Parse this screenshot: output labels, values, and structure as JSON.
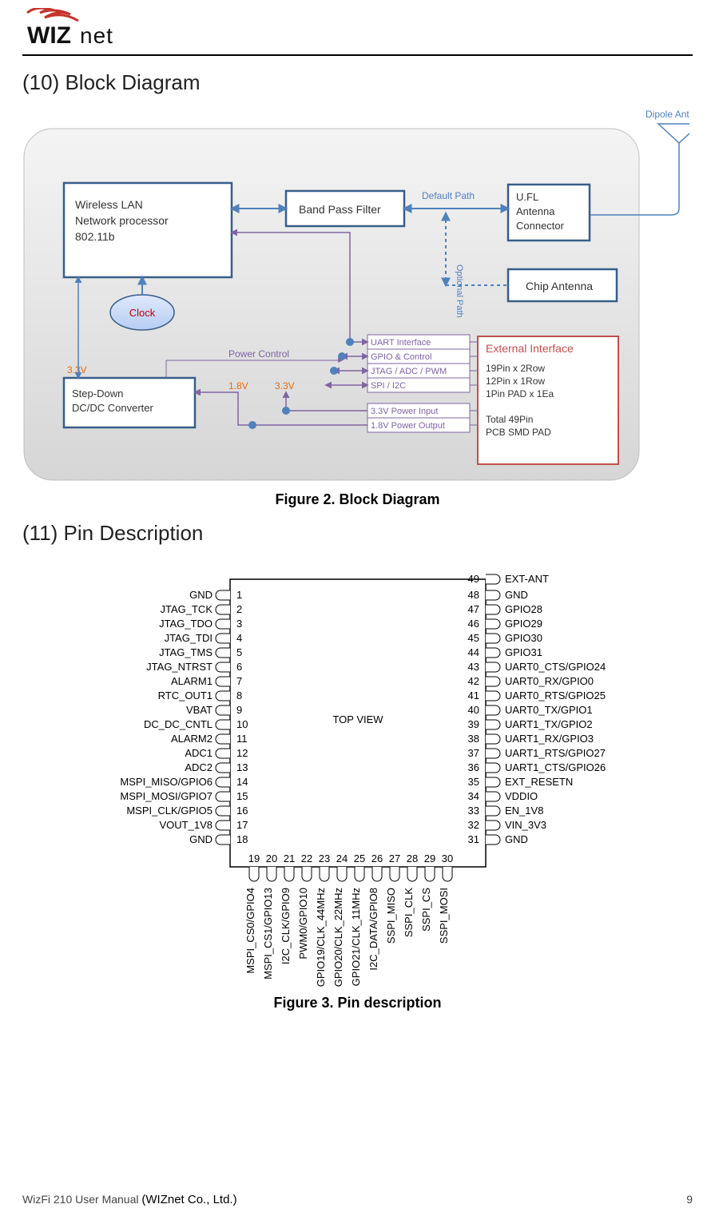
{
  "brand": "WIZnet",
  "section10": "(10) Block Diagram",
  "section11": "(11) Pin Description",
  "fig2": "Figure 2. Block Diagram",
  "fig3": "Figure 3. Pin description",
  "footer_left_a": "WizFi 210 User Manual ",
  "footer_left_b": "(WIZnet Co., Ltd.)",
  "page_num": "9",
  "block": {
    "wlan": "Wireless LAN\nNetwork processor\n802.11b",
    "bpf": "Band Pass Filter",
    "ufl": "U.FL\nAntenna\nConnector",
    "chip": "Chip Antenna",
    "dcdc": "Step-Down\nDC/DC Converter",
    "clock": "Clock",
    "ext_title": "External Interface",
    "ext_body": "19Pin x 2Row\n12Pin x 1Row\n1Pin PAD x 1Ea\n\nTotal 49Pin\nPCB SMD PAD",
    "dipole": "Dipole Antenna",
    "default_path": "Default Path",
    "optional_path": "Optional Path",
    "power_control": "Power Control",
    "v33a": "3.3V",
    "v18": "1.8V",
    "v33b": "3.3V",
    "if1": "UART Interface",
    "if2": "GPIO & Control",
    "if3": "JTAG / ADC / PWM",
    "if4": "SPI / I2C",
    "if5": "3.3V Power Input",
    "if6": "1.8V Power Output"
  },
  "pins": {
    "topview": "TOP VIEW",
    "left": [
      {
        "n": "1",
        "name": "GND"
      },
      {
        "n": "2",
        "name": "JTAG_TCK"
      },
      {
        "n": "3",
        "name": "JTAG_TDO"
      },
      {
        "n": "4",
        "name": "JTAG_TDI"
      },
      {
        "n": "5",
        "name": "JTAG_TMS"
      },
      {
        "n": "6",
        "name": "JTAG_NTRST"
      },
      {
        "n": "7",
        "name": "ALARM1"
      },
      {
        "n": "8",
        "name": "RTC_OUT1"
      },
      {
        "n": "9",
        "name": "VBAT"
      },
      {
        "n": "10",
        "name": "DC_DC_CNTL"
      },
      {
        "n": "11",
        "name": "ALARM2"
      },
      {
        "n": "12",
        "name": "ADC1"
      },
      {
        "n": "13",
        "name": "ADC2"
      },
      {
        "n": "14",
        "name": "MSPI_MISO/GPIO6"
      },
      {
        "n": "15",
        "name": "MSPI_MOSI/GPIO7"
      },
      {
        "n": "16",
        "name": "MSPI_CLK/GPIO5"
      },
      {
        "n": "17",
        "name": "VOUT_1V8"
      },
      {
        "n": "18",
        "name": "GND"
      }
    ],
    "right": [
      {
        "n": "49",
        "name": "EXT-ANT"
      },
      {
        "n": "48",
        "name": "GND"
      },
      {
        "n": "47",
        "name": "GPIO28"
      },
      {
        "n": "46",
        "name": "GPIO29"
      },
      {
        "n": "45",
        "name": "GPIO30"
      },
      {
        "n": "44",
        "name": "GPIO31"
      },
      {
        "n": "43",
        "name": "UART0_CTS/GPIO24"
      },
      {
        "n": "42",
        "name": "UART0_RX/GPIO0"
      },
      {
        "n": "41",
        "name": "UART0_RTS/GPIO25"
      },
      {
        "n": "40",
        "name": "UART0_TX/GPIO1"
      },
      {
        "n": "39",
        "name": "UART1_TX/GPIO2"
      },
      {
        "n": "38",
        "name": "UART1_RX/GPIO3"
      },
      {
        "n": "37",
        "name": "UART1_RTS/GPIO27"
      },
      {
        "n": "36",
        "name": "UART1_CTS/GPIO26"
      },
      {
        "n": "35",
        "name": "EXT_RESETN"
      },
      {
        "n": "34",
        "name": "VDDIO"
      },
      {
        "n": "33",
        "name": "EN_1V8"
      },
      {
        "n": "32",
        "name": "VIN_3V3"
      },
      {
        "n": "31",
        "name": "GND"
      }
    ],
    "bottom": [
      {
        "n": "19",
        "name": "MSPI_CS0/GPIO4"
      },
      {
        "n": "20",
        "name": "MSPI_CS1/GPIO13"
      },
      {
        "n": "21",
        "name": "I2C_CLK/GPIO9"
      },
      {
        "n": "22",
        "name": "PWM0/GPIO10"
      },
      {
        "n": "23",
        "name": "GPIO19/CLK_44MHz"
      },
      {
        "n": "24",
        "name": "GPIO20/CLK_22MHz"
      },
      {
        "n": "25",
        "name": "GPIO21/CLK_11MHz"
      },
      {
        "n": "26",
        "name": "I2C_DATA/GPIO8"
      },
      {
        "n": "27",
        "name": "SSPI_MISO"
      },
      {
        "n": "28",
        "name": "SSPI_CLK"
      },
      {
        "n": "29",
        "name": "SSPI_CS"
      },
      {
        "n": "30",
        "name": "SSPI_MOSI"
      }
    ]
  }
}
